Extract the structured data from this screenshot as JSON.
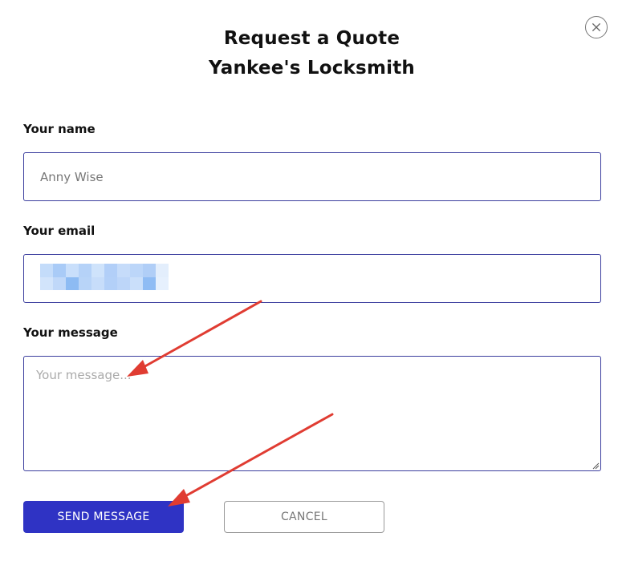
{
  "modal": {
    "title_line1": "Request a Quote",
    "title_line2": "Yankee's Locksmith",
    "close_icon": "close-icon"
  },
  "form": {
    "name": {
      "label": "Your name",
      "value": "Anny Wise"
    },
    "email": {
      "label": "Your email",
      "value_state": "blurred"
    },
    "message": {
      "label": "Your message",
      "placeholder": "Your message..."
    }
  },
  "buttons": {
    "send_label": "SEND MESSAGE",
    "cancel_label": "CANCEL"
  },
  "colors": {
    "primary": "#2f33c4",
    "field_border": "#3b3e9e",
    "annotation_arrow": "#e03c32"
  }
}
